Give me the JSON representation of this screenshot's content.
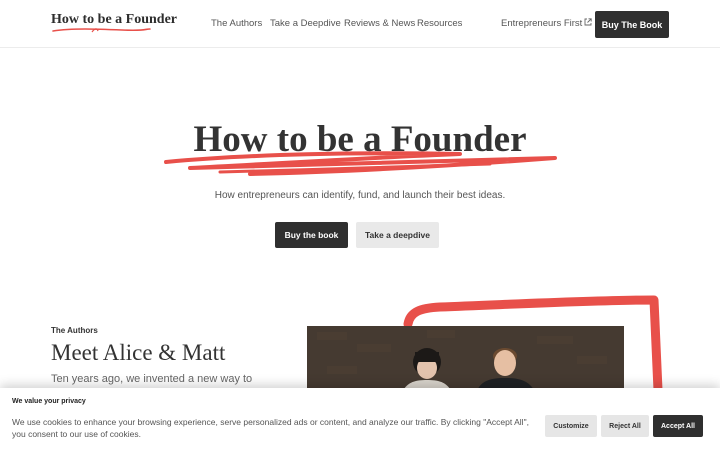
{
  "header": {
    "logo": "How to be a Founder",
    "nav": [
      {
        "label": "The Authors"
      },
      {
        "label": "Take a Deepdive"
      },
      {
        "label": "Reviews & News"
      },
      {
        "label": "Resources"
      }
    ],
    "external_link": {
      "label": "Entrepreneurs First",
      "icon": "external-link-icon"
    },
    "buy_button": "Buy The Book"
  },
  "hero": {
    "title": "How to be a Founder",
    "subtitle": "How entrepreneurs can identify, fund, and launch their best ideas.",
    "primary_button": "Buy the book",
    "secondary_button": "Take a deepdive",
    "accent_color": "#e8504a"
  },
  "authors": {
    "label": "The Authors",
    "title": "Meet Alice & Matt",
    "text": "Ten years ago, we invented a new way to"
  },
  "cookie_banner": {
    "title": "We value your privacy",
    "text": "We use cookies to enhance your browsing experience, serve personalized ads or content, and analyze our traffic. By clicking \"Accept All\", you consent to our use of cookies.",
    "buttons": {
      "customize": "Customize",
      "reject": "Reject All",
      "accept": "Accept All"
    }
  }
}
